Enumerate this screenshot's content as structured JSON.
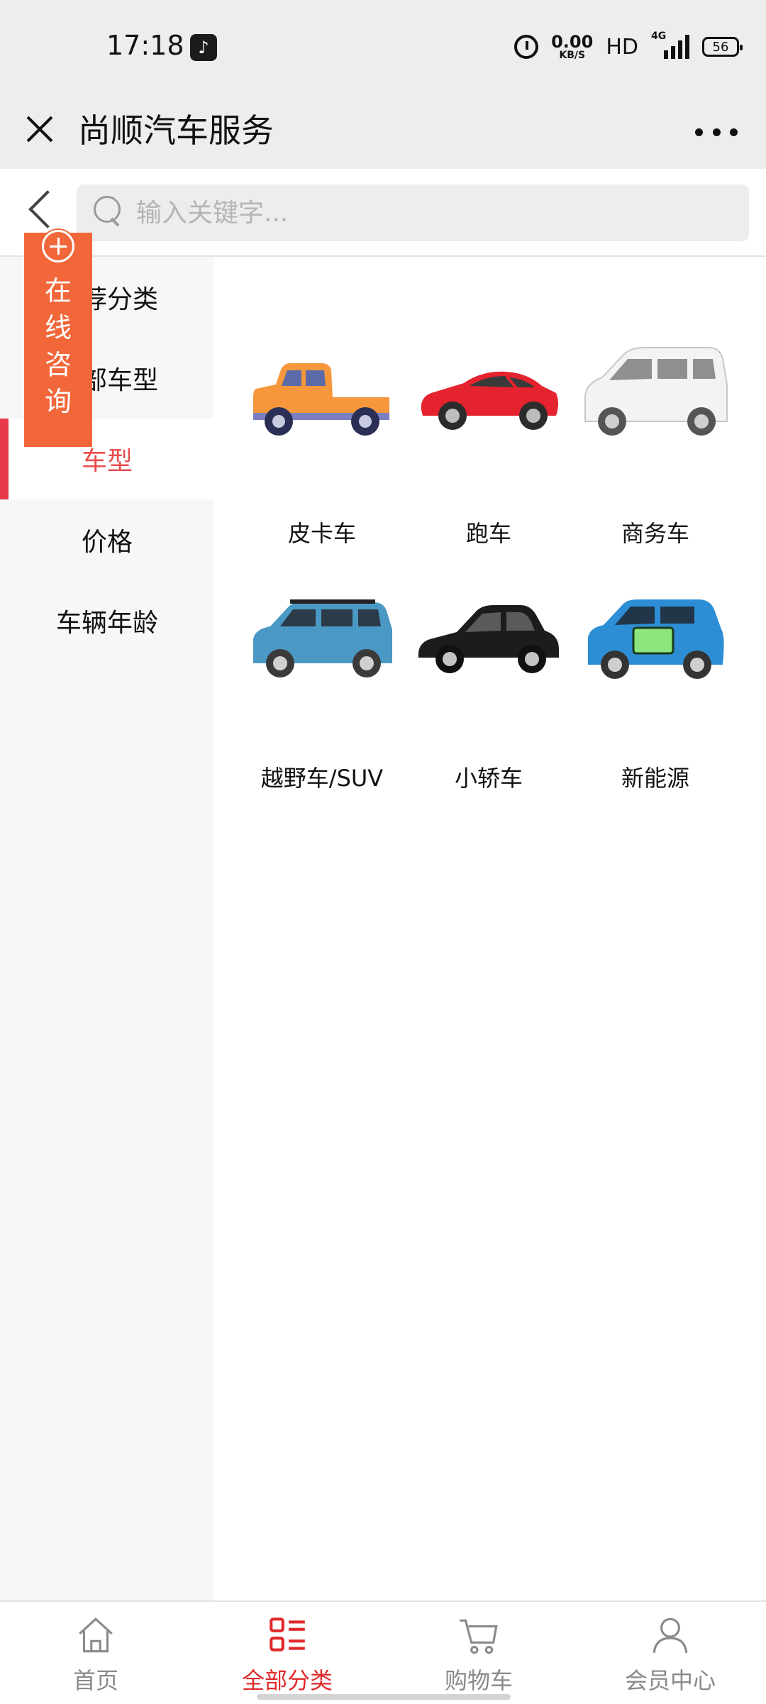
{
  "status_bar": {
    "time": "17:18",
    "speed_value": "0.00",
    "speed_unit": "KB/S",
    "hd": "HD",
    "network": "4G",
    "battery": "56"
  },
  "title_bar": {
    "title": "尚顺汽车服务"
  },
  "search": {
    "placeholder": "输入关键字..."
  },
  "sidebar": {
    "items": [
      {
        "label": "推荐分类"
      },
      {
        "label": "全部车型"
      },
      {
        "label": "车型"
      },
      {
        "label": "价格"
      },
      {
        "label": "车辆年龄"
      }
    ],
    "active_index": 2
  },
  "consult_button": {
    "label": "在线咨询"
  },
  "categories": [
    {
      "label": "皮卡车",
      "icon": "pickup-truck-icon",
      "color": "#f5973a"
    },
    {
      "label": "跑车",
      "icon": "sports-car-icon",
      "color": "#e5232e"
    },
    {
      "label": "商务车",
      "icon": "minivan-icon",
      "color": "#f2f2f2"
    },
    {
      "label": "越野车/SUV",
      "icon": "suv-icon",
      "color": "#4a98c4"
    },
    {
      "label": "小轿车",
      "icon": "sedan-icon",
      "color": "#1c1c1c"
    },
    {
      "label": "新能源",
      "icon": "ev-car-icon",
      "color": "#2d8ed6"
    }
  ],
  "tabbar": {
    "tabs": [
      {
        "label": "首页",
        "icon": "home-icon"
      },
      {
        "label": "全部分类",
        "icon": "category-icon"
      },
      {
        "label": "购物车",
        "icon": "cart-icon"
      },
      {
        "label": "会员中心",
        "icon": "user-icon"
      }
    ],
    "active_index": 1
  },
  "colors": {
    "accent": "#e02a2a",
    "consult": "#f2673a"
  }
}
